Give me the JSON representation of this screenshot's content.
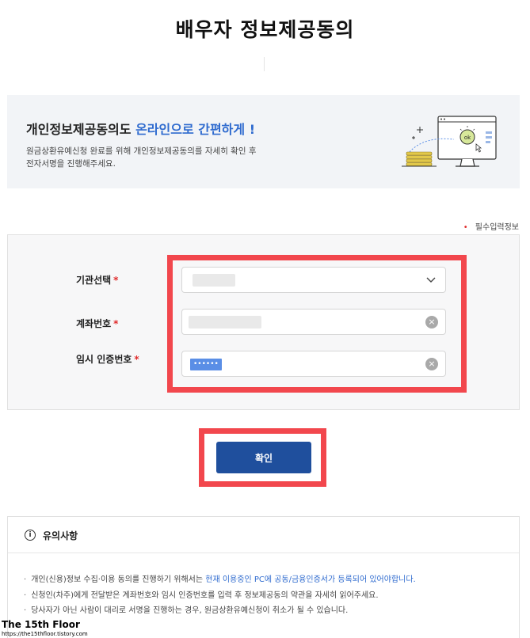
{
  "page": {
    "title": "배우자 정보제공동의"
  },
  "banner": {
    "headline_prefix": "개인정보제공동의도",
    "headline_accent": "온라인으로 간편하게",
    "headline_suffix": "!",
    "desc_line1": "원금상환유예신청 완료를 위해 개인정보제공동의를 자세히 확인 후",
    "desc_line2": "전자서명을 진행해주세요.",
    "illustration_icon": "monitor-ok-coins-illustration",
    "illustration_text": "ok"
  },
  "form": {
    "required_note": "필수입력정보",
    "required_mark": "•",
    "institution": {
      "label": "기관선택",
      "required": "*"
    },
    "account": {
      "label": "계좌번호",
      "required": "*"
    },
    "temp_cert": {
      "label": "임시 인증번호",
      "required": "*",
      "value_mask": "••••••"
    },
    "clear_glyph": "×"
  },
  "actions": {
    "confirm_label": "확인"
  },
  "notice": {
    "title": "유의사항",
    "info_glyph": "i",
    "items": [
      {
        "text": "개인(신용)정보 수집·이용 동의를 진행하기 위해서는 ",
        "link": "현재 이용중인 PC에 공동/금융인증서가 등록되어 있어야합니다."
      },
      {
        "text": "신청인(차주)에게 전달받은 계좌번호와 임시 인증번호를 입력 후 정보제공동의 약관을 자세히 읽어주세요."
      },
      {
        "text": "당사자가 아닌 사람이 대리로 서명을 진행하는 경우, 원금상환유예신청이 취소가 될 수 있습니다."
      }
    ]
  },
  "watermark": {
    "title": "The 15th Floor",
    "url": "https://the15thfloor.tistory.com"
  },
  "colors": {
    "accent": "#2f6bcf",
    "primary_button": "#1f4f9d",
    "highlight": "#f2474d",
    "required": "#e02b2b"
  }
}
